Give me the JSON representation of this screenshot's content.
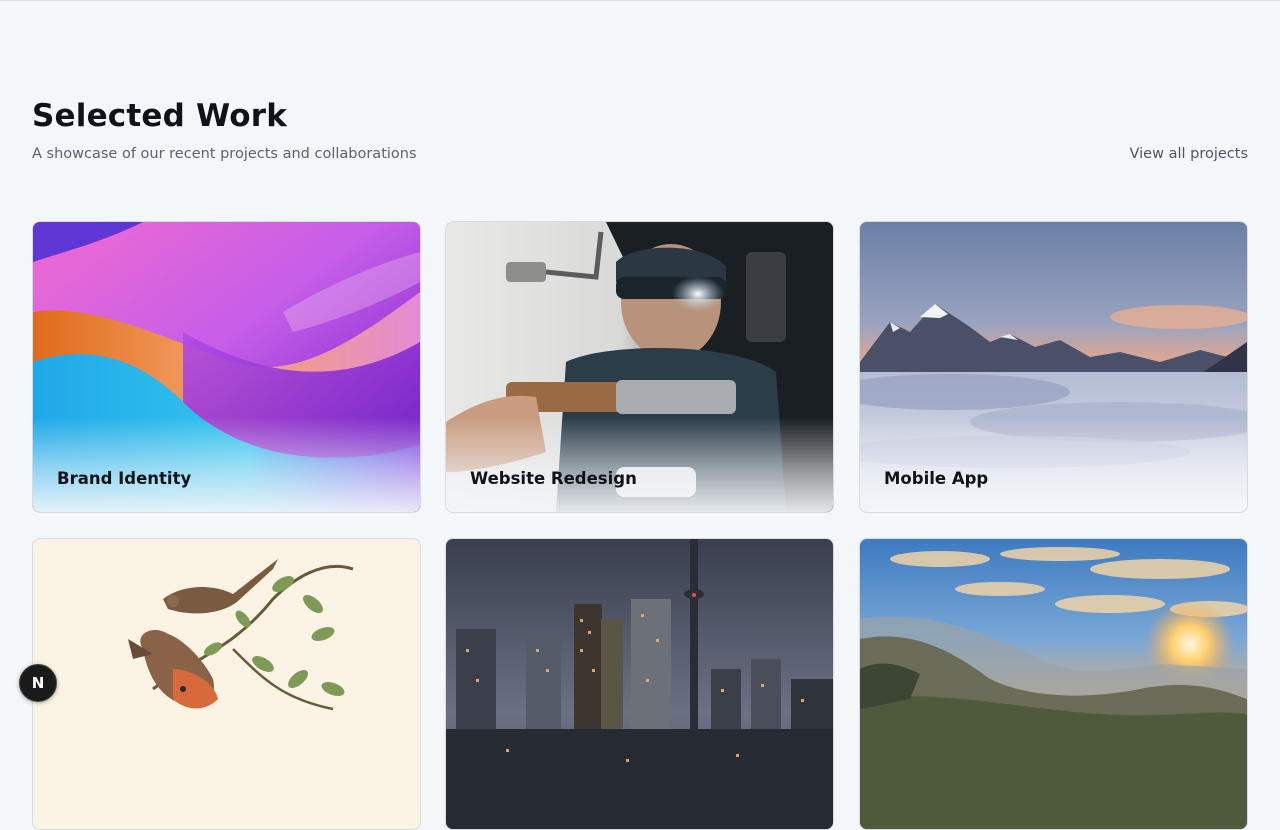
{
  "section": {
    "title": "Selected Work",
    "subtitle": "A showcase of our recent projects and collaborations",
    "view_all_label": "View all projects"
  },
  "projects": [
    {
      "title": "Brand Identity"
    },
    {
      "title": "Website Redesign"
    },
    {
      "title": "Mobile App"
    },
    {
      "title": ""
    },
    {
      "title": ""
    },
    {
      "title": ""
    }
  ],
  "badge": {
    "letter": "N",
    "icon": "next-logo-icon"
  },
  "colors": {
    "background": "#f4f7fa",
    "heading": "#0f1218",
    "muted_text": "#5c636c",
    "card_border": "#d6dbe1"
  }
}
